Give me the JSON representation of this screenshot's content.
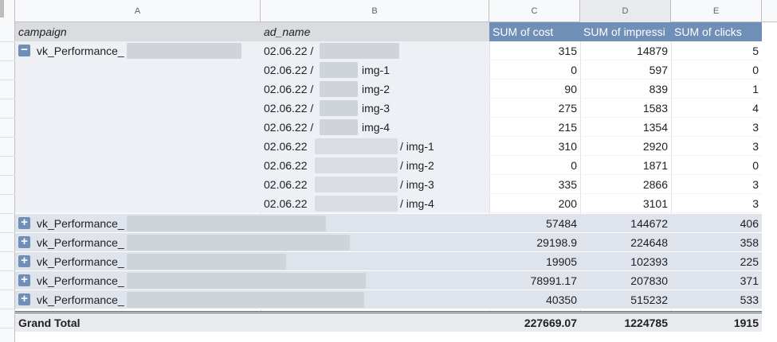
{
  "column_headers": [
    "A",
    "B",
    "C",
    "D",
    "E"
  ],
  "pivot_header": {
    "campaign": "campaign",
    "ad_name": "ad_name",
    "cost": "SUM of cost",
    "impressions": "SUM of impressi",
    "clicks": "SUM of clicks"
  },
  "expanded_group": {
    "toggle": "−",
    "campaign_label": "vk_Performance_",
    "rows": [
      {
        "date": "02.06.22 /",
        "suffix": "",
        "cost": "315",
        "impressions": "14879",
        "clicks": "5"
      },
      {
        "date": "02.06.22 /",
        "suffix": "img-1",
        "cost": "0",
        "impressions": "597",
        "clicks": "0"
      },
      {
        "date": "02.06.22 /",
        "suffix": "img-2",
        "cost": "90",
        "impressions": "839",
        "clicks": "1"
      },
      {
        "date": "02.06.22 /",
        "suffix": "img-3",
        "cost": "275",
        "impressions": "1583",
        "clicks": "4"
      },
      {
        "date": "02.06.22 /",
        "suffix": "img-4",
        "cost": "215",
        "impressions": "1354",
        "clicks": "3"
      },
      {
        "date": "02.06.22",
        "suffix": "/ img-1",
        "cost": "310",
        "impressions": "2920",
        "clicks": "3"
      },
      {
        "date": "02.06.22",
        "suffix": "/ img-2",
        "cost": "0",
        "impressions": "1871",
        "clicks": "0"
      },
      {
        "date": "02.06.22",
        "suffix": "/ img-3",
        "cost": "335",
        "impressions": "2866",
        "clicks": "3"
      },
      {
        "date": "02.06.22",
        "suffix": "/ img-4",
        "cost": "200",
        "impressions": "3101",
        "clicks": "3"
      }
    ]
  },
  "collapsed_groups": [
    {
      "toggle": "+",
      "campaign_label": "vk_Performance_",
      "cost": "57484",
      "impressions": "144672",
      "clicks": "406"
    },
    {
      "toggle": "+",
      "campaign_label": "vk_Performance_",
      "cost": "29198.9",
      "impressions": "224648",
      "clicks": "358"
    },
    {
      "toggle": "+",
      "campaign_label": "vk_Performance_",
      "cost": "19905",
      "impressions": "102393",
      "clicks": "225"
    },
    {
      "toggle": "+",
      "campaign_label": "vk_Performance_",
      "cost": "78991.17",
      "impressions": "207830",
      "clicks": "371"
    },
    {
      "toggle": "+",
      "campaign_label": "vk_Performance_",
      "cost": "40350",
      "impressions": "515232",
      "clicks": "533"
    }
  ],
  "grand_total": {
    "label": "Grand Total",
    "cost": "227669.07",
    "impressions": "1224785",
    "clicks": "1915"
  },
  "colors": {
    "header_accent": "#6f8fb7",
    "collapsed_row": "#dfe3ec",
    "total_row": "#e8eaed"
  }
}
